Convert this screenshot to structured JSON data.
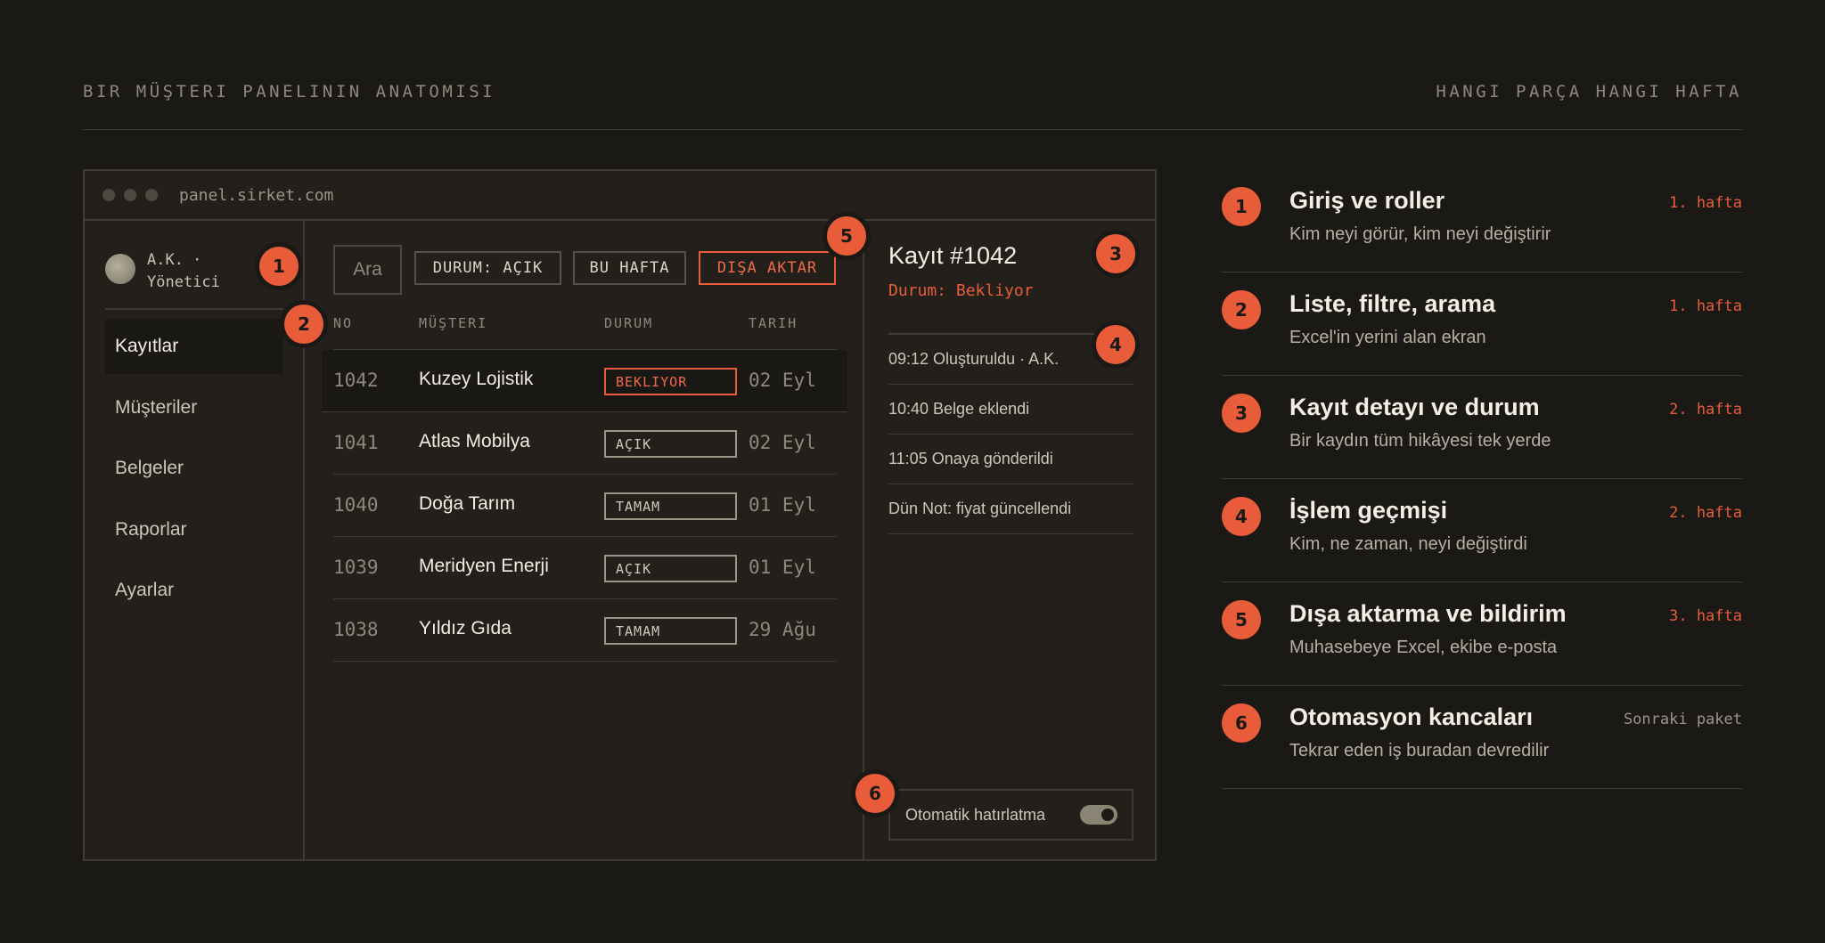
{
  "header": {
    "left": "BIR MÜŞTERI PANELININ ANATOMISI",
    "right": "HANGI PARÇA HANGI HAFTA"
  },
  "window": {
    "url": "panel.sirket.com"
  },
  "sidebar": {
    "user_line1": "A.K. ·",
    "user_line2": "Yönetici",
    "items": [
      {
        "label": "Kayıtlar",
        "active": true
      },
      {
        "label": "Müşteriler"
      },
      {
        "label": "Belgeler"
      },
      {
        "label": "Raporlar"
      },
      {
        "label": "Ayarlar"
      }
    ]
  },
  "toolbar": {
    "search_placeholder": "Ara",
    "filter_status": "DURUM: AÇIK",
    "filter_week": "BU HAFTA",
    "export": "DIŞA AKTAR"
  },
  "table": {
    "columns": [
      "NO",
      "MÜŞTERI",
      "DURUM",
      "TARIH"
    ],
    "rows": [
      {
        "no": "1042",
        "customer": "Kuzey Lojistik",
        "status": "BEKLIYOR",
        "date": "02 Eyl"
      },
      {
        "no": "1041",
        "customer": "Atlas Mobilya",
        "status": "AÇIK",
        "date": "02 Eyl"
      },
      {
        "no": "1040",
        "customer": "Doğa Tarım",
        "status": "TAMAM",
        "date": "01 Eyl"
      },
      {
        "no": "1039",
        "customer": "Meridyen Enerji",
        "status": "AÇIK",
        "date": "01 Eyl"
      },
      {
        "no": "1038",
        "customer": "Yıldız Gıda",
        "status": "TAMAM",
        "date": "29 Ağu"
      }
    ]
  },
  "detail": {
    "title": "Kayıt #1042",
    "status": "Durum: Bekliyor",
    "timeline": [
      "09:12 Oluşturuldu · A.K.",
      "10:40 Belge eklendi",
      "11:05 Onaya gönderildi",
      "Dün Not: fiyat güncellendi"
    ],
    "toggle_label": "Otomatik hatırlatma",
    "toggle_on": true
  },
  "markers": [
    "1",
    "2",
    "3",
    "4",
    "5",
    "6"
  ],
  "legend": [
    {
      "num": "1",
      "title": "Giriş ve roller",
      "desc": "Kim neyi görür, kim neyi değiştirir",
      "week": "1. hafta"
    },
    {
      "num": "2",
      "title": "Liste, filtre, arama",
      "desc": "Excel'in yerini alan ekran",
      "week": "1. hafta"
    },
    {
      "num": "3",
      "title": "Kayıt detayı ve durum",
      "desc": "Bir kaydın tüm hikâyesi tek yerde",
      "week": "2. hafta"
    },
    {
      "num": "4",
      "title": "İşlem geçmişi",
      "desc": "Kim, ne zaman, neyi değiştirdi",
      "week": "2. hafta"
    },
    {
      "num": "5",
      "title": "Dışa aktarma ve bildirim",
      "desc": "Muhasebeye Excel, ekibe e-posta",
      "week": "3. hafta"
    },
    {
      "num": "6",
      "title": "Otomasyon kancaları",
      "desc": "Tekrar eden iş buradan devredilir",
      "week": "Sonraki paket"
    }
  ],
  "colors": {
    "accent": "#e85c3a",
    "background": "#1b1915",
    "panel": "#23201b"
  }
}
